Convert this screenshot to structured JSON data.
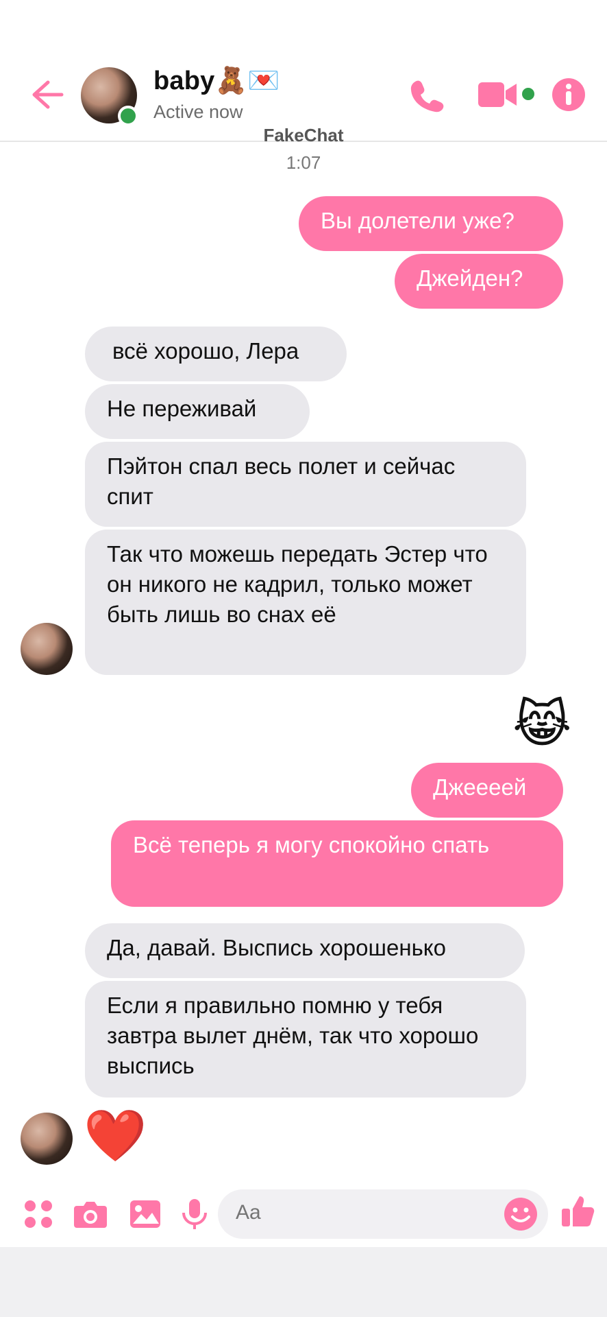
{
  "header": {
    "contact_name": "baby🧸💌",
    "status": "Active now",
    "watermark": "FakeChat"
  },
  "timestamp": "1:07",
  "messages": [
    {
      "dir": "out",
      "text": "Вы долетели уже?"
    },
    {
      "dir": "out",
      "text": "Джейден?"
    },
    {
      "dir": "in",
      "text": "всё хорошо, Лера"
    },
    {
      "dir": "in",
      "text": "Не переживай"
    },
    {
      "dir": "in",
      "text": "Пэйтон спал весь полет и сейчас спит"
    },
    {
      "dir": "in",
      "text": "Так что можешь передать Эстер что он никого не кадрил, только может быть лишь во снах её"
    },
    {
      "dir": "out",
      "text": "😹"
    },
    {
      "dir": "out",
      "text": "Джеееей"
    },
    {
      "dir": "out",
      "text": "Всё теперь я могу спокойно спать"
    },
    {
      "dir": "in",
      "text": "Да, давай. Выспись хорошенько"
    },
    {
      "dir": "in",
      "text": "Если я правильно помню у тебя завтра вылет днём, так что хорошо выспись"
    },
    {
      "dir": "in",
      "text": "❤️"
    }
  ],
  "composer": {
    "placeholder": "Aa"
  },
  "icons": {
    "back": "arrow-left-icon",
    "call": "phone-icon",
    "video": "video-camera-icon",
    "info": "info-icon",
    "apps": "apps-icon",
    "camera": "camera-icon",
    "gallery": "image-icon",
    "voice": "microphone-icon",
    "emoji": "smile-icon",
    "like": "thumbs-up-icon"
  },
  "colors": {
    "accent": "#ff77a8",
    "incoming_bubble": "#e9e8ec",
    "online": "#31a24c"
  }
}
